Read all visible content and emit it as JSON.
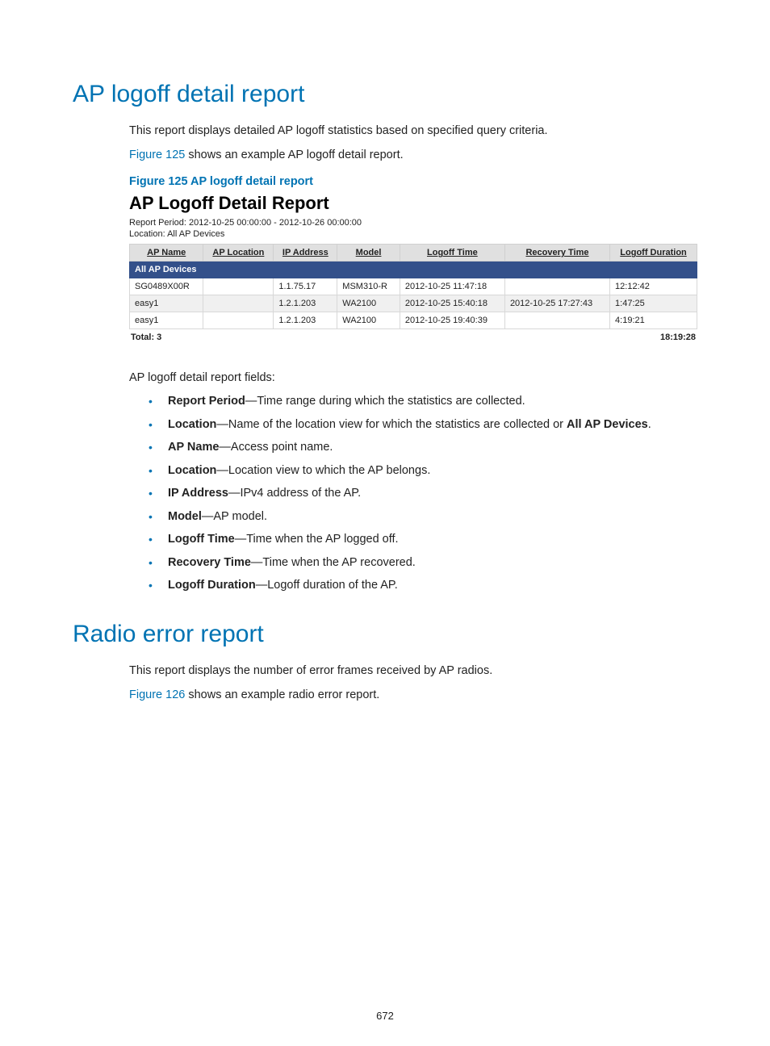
{
  "page_number": "672",
  "section1": {
    "title": "AP logoff detail report",
    "intro": "This report displays detailed AP logoff statistics based on specified query criteria.",
    "figref_link": "Figure 125",
    "figref_tail": " shows an example AP logoff detail report.",
    "figcap": "Figure 125 AP logoff detail report",
    "report_title": "AP Logoff Detail Report",
    "meta_period": "Report Period: 2012-10-25 00:00:00  -  2012-10-26 00:00:00",
    "meta_location": "Location: All AP Devices",
    "headers": {
      "h1": "AP Name",
      "h2": "AP Location",
      "h3": "IP Address",
      "h4": "Model",
      "h5": "Logoff Time",
      "h6": "Recovery Time",
      "h7": "Logoff Duration"
    },
    "group_label": "All AP Devices",
    "rows": [
      {
        "name": "SG0489X00R",
        "loc": "",
        "ip": "1.1.75.17",
        "model": "MSM310-R",
        "logoff": "2012-10-25 11:47:18",
        "recov": "",
        "dur": "12:12:42"
      },
      {
        "name": "easy1",
        "loc": "",
        "ip": "1.2.1.203",
        "model": "WA2100",
        "logoff": "2012-10-25 15:40:18",
        "recov": "2012-10-25 17:27:43",
        "dur": "1:47:25"
      },
      {
        "name": "easy1",
        "loc": "",
        "ip": "1.2.1.203",
        "model": "WA2100",
        "logoff": "2012-10-25 19:40:39",
        "recov": "",
        "dur": "4:19:21"
      }
    ],
    "total_left": "Total: 3",
    "total_right": "18:19:28",
    "fields_intro": "AP logoff detail report fields:",
    "fields": [
      {
        "term": "Report Period",
        "desc": "—Time range during which the statistics are collected."
      },
      {
        "term": "Location",
        "desc": "—Name of the location view for which the statistics are collected or ",
        "tail_bold": "All AP Devices",
        "tail": "."
      },
      {
        "term": "AP Name",
        "desc": "—Access point name."
      },
      {
        "term": "Location",
        "desc": "—Location view to which the AP belongs."
      },
      {
        "term": "IP Address",
        "desc": "—IPv4 address of the AP."
      },
      {
        "term": "Model",
        "desc": "—AP model."
      },
      {
        "term": "Logoff Time",
        "desc": "—Time when the AP logged off."
      },
      {
        "term": "Recovery Time",
        "desc": "—Time when the AP recovered."
      },
      {
        "term": "Logoff Duration",
        "desc": "—Logoff duration of the AP."
      }
    ]
  },
  "section2": {
    "title": "Radio error report",
    "intro": "This report displays the number of error frames received by AP radios.",
    "figref_link": "Figure 126",
    "figref_tail": " shows an example radio error report."
  }
}
